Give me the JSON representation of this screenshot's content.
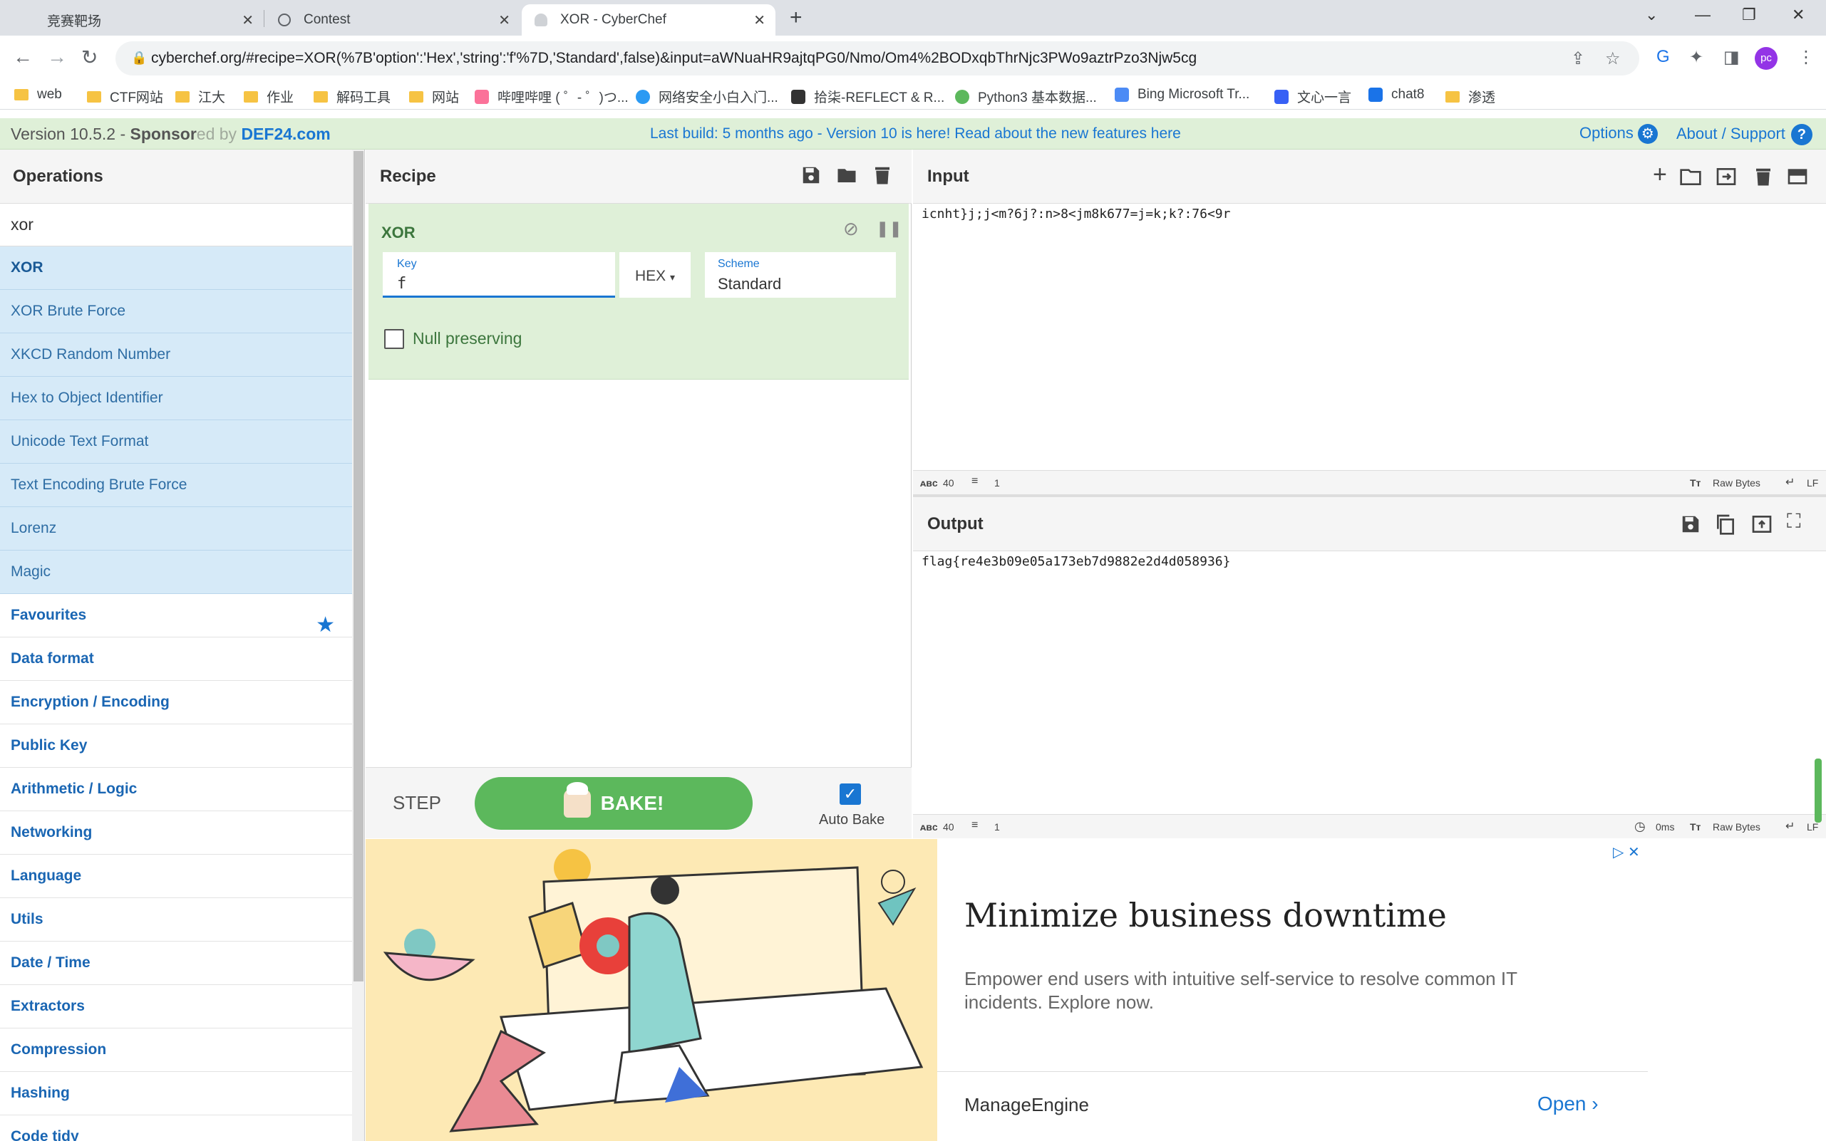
{
  "browser": {
    "tabs": [
      {
        "title": "竞赛靶场",
        "close": "✕"
      },
      {
        "title": "Contest",
        "close": "✕"
      },
      {
        "title": "XOR - CyberChef",
        "close": "✕"
      }
    ],
    "new_tab": "+",
    "url": "cyberchef.org/#recipe=XOR(%7B'option':'Hex','string':'f'%7D,'Standard',false)&input=aWNuaHR9ajtqPG0/Nmo/Om4%2BODxqbThrNjc3PWo9aztrPzo3Njw5cg",
    "profile_initials": "pc",
    "bookmarks": [
      {
        "label": "web",
        "type": "folder"
      },
      {
        "label": "CTF网站",
        "type": "folder"
      },
      {
        "label": "江大",
        "type": "folder"
      },
      {
        "label": "作业",
        "type": "folder"
      },
      {
        "label": "解码工具",
        "type": "folder"
      },
      {
        "label": "网站",
        "type": "folder"
      },
      {
        "label": "哔哩哔哩 ( ゜- ゜)つ...",
        "type": "site"
      },
      {
        "label": "网络安全小白入门...",
        "type": "site"
      },
      {
        "label": "拾柒-REFLECT & R...",
        "type": "site"
      },
      {
        "label": "Python3 基本数据...",
        "type": "site"
      },
      {
        "label": "Bing Microsoft Tr...",
        "type": "site"
      },
      {
        "label": "文心一言",
        "type": "site"
      },
      {
        "label": "chat8",
        "type": "site"
      },
      {
        "label": "渗透",
        "type": "folder"
      }
    ]
  },
  "banner": {
    "version_prefix": "Version 10.5.2 - ",
    "sponsor_text": "Sponsor",
    "sponsor_tail": "ed by ",
    "sponsor_name": "DEF24.com",
    "build_notice": "Last build: 5 months ago - Version 10 is here! Read about the new features here",
    "options": "Options",
    "about": "About / Support"
  },
  "operations": {
    "title": "Operations",
    "search_value": "xor",
    "results": [
      "XOR",
      "XOR Brute Force",
      "XKCD Random Number",
      "Hex to Object Identifier",
      "Unicode Text Format",
      "Text Encoding Brute Force",
      "Lorenz",
      "Magic"
    ],
    "categories": [
      "Favourites",
      "Data format",
      "Encryption / Encoding",
      "Public Key",
      "Arithmetic / Logic",
      "Networking",
      "Language",
      "Utils",
      "Date / Time",
      "Extractors",
      "Compression",
      "Hashing",
      "Code tidy"
    ]
  },
  "recipe": {
    "title": "Recipe",
    "operation": {
      "name": "XOR",
      "key_label": "Key",
      "key_value": "f",
      "key_format": "HEX",
      "scheme_label": "Scheme",
      "scheme_value": "Standard",
      "null_preserving_label": "Null preserving",
      "null_preserving": false
    },
    "step_label": "STEP",
    "bake_label": "BAKE!",
    "autobake_label": "Auto Bake",
    "autobake": true
  },
  "input": {
    "title": "Input",
    "text": "icnht}j;j<m?6j?:n>8<jm8k677=j=k;k?:76<9r",
    "length": "40",
    "lines": "1",
    "format": "Raw Bytes",
    "eol": "LF"
  },
  "output": {
    "title": "Output",
    "text": "flag{re4e3b09e05a173eb7d9882e2d4d058936}",
    "length": "40",
    "lines": "1",
    "time": "0ms",
    "format": "Raw Bytes",
    "eol": "LF"
  },
  "ad": {
    "headline": "Minimize business downtime",
    "body": "Empower end users with intuitive self-service to resolve common IT incidents. Explore now.",
    "brand": "ManageEngine",
    "cta": "Open"
  }
}
